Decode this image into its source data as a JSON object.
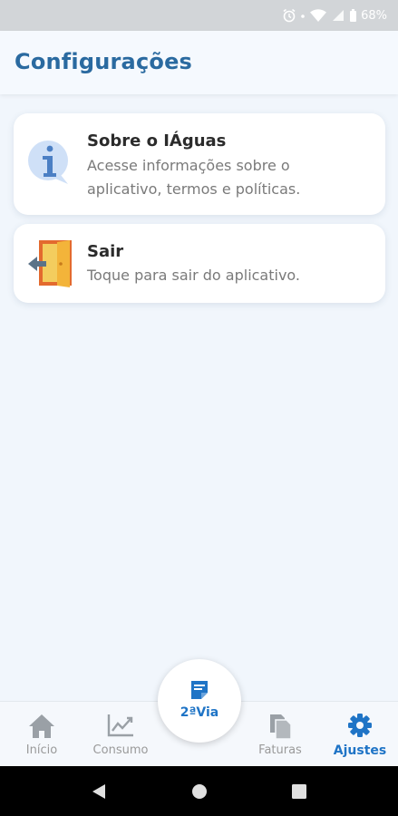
{
  "status_bar": {
    "battery": "68%",
    "icons": [
      "alarm-icon",
      "wifi-icon",
      "signal-icon",
      "battery-icon"
    ]
  },
  "header": {
    "title": "Configurações"
  },
  "settings": {
    "about": {
      "title": "Sobre o IÁguas",
      "description": "Acesse informações sobre o aplicativo, termos e políticas.",
      "icon": "info-icon"
    },
    "logout": {
      "title": "Sair",
      "description": "Toque para sair do aplicativo.",
      "icon": "logout-door-icon"
    }
  },
  "bottom_nav": {
    "items": [
      {
        "label": "Início",
        "icon": "home-icon",
        "active": false
      },
      {
        "label": "Consumo",
        "icon": "chart-icon",
        "active": false
      },
      {
        "label": "Faturas",
        "icon": "invoices-icon",
        "active": false
      },
      {
        "label": "Ajustes",
        "icon": "gear-icon",
        "active": true
      }
    ],
    "center_button": {
      "label": "2ªVia",
      "icon": "document-icon"
    }
  },
  "colors": {
    "primary": "#1f74c6",
    "title": "#2a6aa0",
    "inactive": "#9a9a9a",
    "background": "#f1f6fc"
  }
}
